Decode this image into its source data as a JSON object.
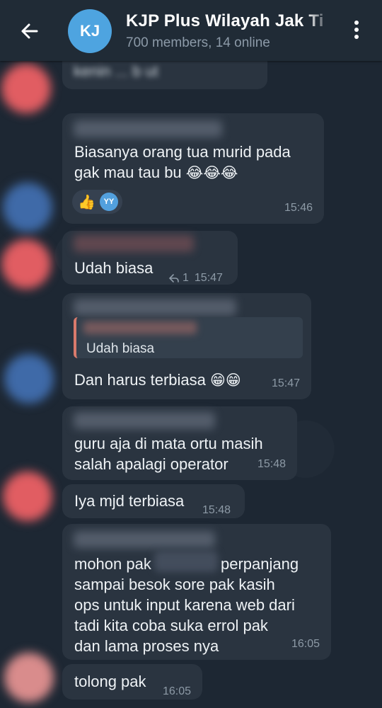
{
  "header": {
    "avatar_initials": "KJ",
    "title": "KJP Plus Wilayah Jak Ti",
    "subtitle": "700 members, 14 online",
    "back_icon": "arrow-left-icon",
    "menu_icon": "more-vertical-icon"
  },
  "messages": [
    {
      "text": "kenin ... b ut",
      "time": ""
    },
    {
      "text_line1": "Biasanya orang tua murid pada",
      "text_line2": "gak mau tau bu",
      "emojis": "😂😂😂",
      "time": "15:46",
      "reaction_emoji": "👍",
      "reaction_user": "YY"
    },
    {
      "text": "Udah biasa",
      "reply_count": "1",
      "time": "15:47"
    },
    {
      "quoted_text": "Udah biasa",
      "text": "Dan harus terbiasa",
      "emojis": "😁😁",
      "time": "15:47"
    },
    {
      "text_line1": "guru aja di mata ortu masih",
      "text_line2": "salah apalagi operator",
      "time": "15:48"
    },
    {
      "text": "Iya mjd terbiasa",
      "time": "15:48"
    },
    {
      "text_line1": "mohon pak",
      "text_line1b": "perpanjang",
      "text_line2": "sampai besok sore pak kasih",
      "text_line3": "ops untuk input karena web dari",
      "text_line4": "tadi kita coba suka errol pak",
      "text_line5": "dan lama proses nya",
      "time": "16:05"
    },
    {
      "text": "tolong pak",
      "time": "16:05"
    }
  ],
  "colors": {
    "header_bg": "#202b36",
    "bubble_bg": "#2a3440",
    "avatar_accent": "#4ea4e0"
  }
}
